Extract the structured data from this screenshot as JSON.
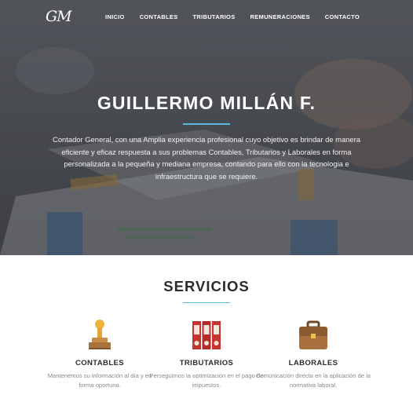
{
  "nav": {
    "logo": "GM",
    "items": [
      "INICIO",
      "CONTABLES",
      "TRIBUTARIOS",
      "REMUNERACIONES",
      "CONTACTO"
    ]
  },
  "hero": {
    "title": "GUILLERMO MILLÁN F.",
    "text": "Contador General, con una Amplia experiencia profesional cuyo objetivo es brindar de manera eficiente y eficaz respuesta a sus problemas Contables, Tributarios y Laborales en forma personalizada a la pequeña y mediana empresa, contando para ello con la tecnologia e infraestructura que se requiere."
  },
  "services": {
    "title": "SERVICIOS",
    "items": [
      {
        "icon": "stamp-icon",
        "title": "CONTABLES",
        "desc": "Mantenemos su información al día y en forma oportuna."
      },
      {
        "icon": "binders-icon",
        "title": "TRIBUTARIOS",
        "desc": "Perseguimos la optimizacion en el pago de impuestos."
      },
      {
        "icon": "briefcase-icon",
        "title": "LABORALES",
        "desc": "Comunicación directa en la aplicación de la normativa laboral."
      }
    ]
  },
  "colors": {
    "accent": "#5bb7e6",
    "hero_overlay": "#1e2024",
    "heading": "#2b2b2b",
    "body_text": "#8a8a8a"
  }
}
